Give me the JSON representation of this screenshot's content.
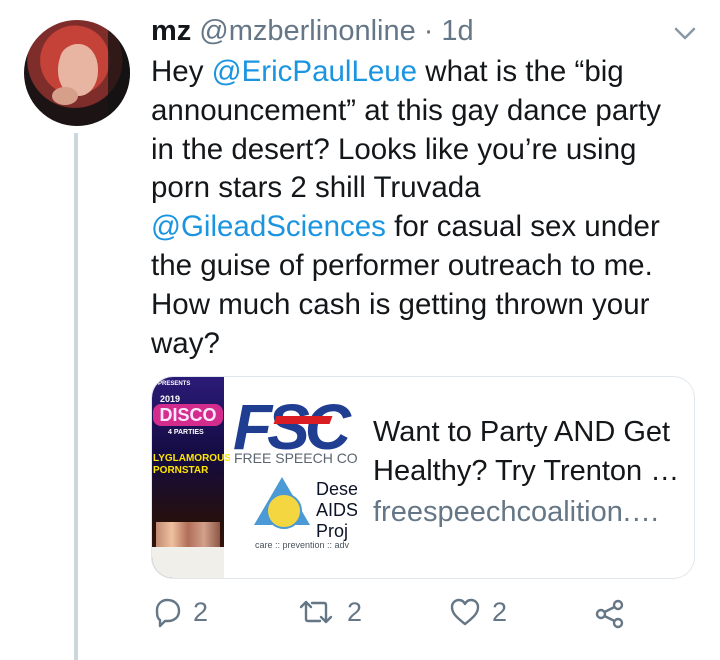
{
  "tweet": {
    "author": {
      "name": "mz",
      "handle": "@mzberlinonline",
      "separator": "·",
      "time": "1d"
    },
    "text_segments": [
      {
        "text": "Hey ",
        "type": "plain"
      },
      {
        "text": "@EricPaulLeue",
        "type": "mention"
      },
      {
        "text": " what is the “big",
        "type": "plain"
      },
      {
        "text": "announcement” at this gay dance party",
        "type": "plain"
      },
      {
        "text": "in the desert? Looks like you’re using",
        "type": "plain"
      },
      {
        "text": "porn stars 2 shill Truvada",
        "type": "plain"
      },
      {
        "text": "@GileadSciences",
        "type": "mention"
      },
      {
        "text": " for casual sex under",
        "type": "plain"
      },
      {
        "text": "the guise of performer outreach to me.",
        "type": "plain"
      },
      {
        "text": "How much cash is getting thrown your",
        "type": "plain"
      },
      {
        "text": "way?",
        "type": "plain"
      }
    ],
    "link_card": {
      "title_line_1": "Want to Party AND Get",
      "title_line_2": "Healthy? Try Trenton …",
      "domain": "freespeechcoalition.…",
      "image_text": {
        "poster_top": "PRESENTS",
        "poster_date": "2019",
        "poster_title": "DISCO",
        "poster_line": "4 PARTIES",
        "poster_glam": "LYGLAMOROUS",
        "poster_star": "PORNSTAR",
        "fsc_logo": "FSC",
        "fsc_small": "FREE SPEECH COA",
        "desert_line_1": "Dese",
        "desert_line_2": "AIDS",
        "desert_line_3": "Proj",
        "care_line": "care :: prevention :: adv"
      }
    },
    "actions": {
      "reply_count": "2",
      "retweet_count": "2",
      "like_count": "2"
    }
  },
  "icons": {
    "avatar": "avatar",
    "menu": "chevron-down-icon",
    "reply": "reply-icon",
    "retweet": "retweet-icon",
    "like": "heart-icon",
    "share": "share-icon"
  },
  "colors": {
    "primary_text": "#14171a",
    "secondary_text": "#657786",
    "mention": "#1b95e0",
    "border": "#e1e8ed",
    "thread_line": "#ccd6dd"
  }
}
